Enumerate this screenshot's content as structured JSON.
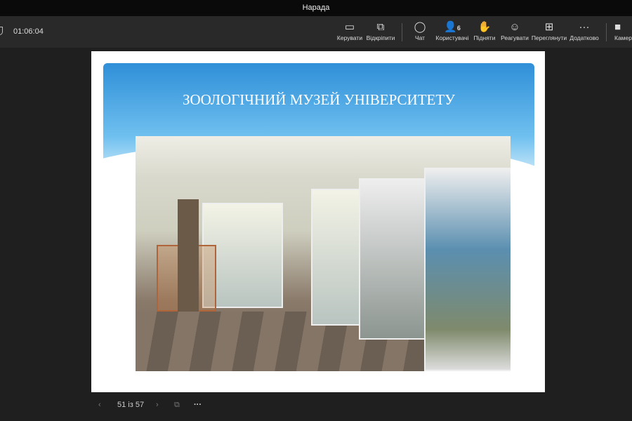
{
  "window": {
    "title": "Нарада"
  },
  "toolbar": {
    "timer": "01:06:04",
    "items": [
      {
        "label": "Керувати",
        "icon": "share-screen-icon"
      },
      {
        "label": "Відкріпити",
        "icon": "popout-icon"
      },
      {
        "label": "Чат",
        "icon": "chat-icon"
      },
      {
        "label": "Користувачі",
        "icon": "people-icon",
        "badge": "6"
      },
      {
        "label": "Підняти",
        "icon": "raise-hand-icon"
      },
      {
        "label": "Реагувати",
        "icon": "smiley-icon"
      },
      {
        "label": "Переглянути",
        "icon": "grid-view-icon"
      },
      {
        "label": "Додатково",
        "icon": "more-icon"
      },
      {
        "label": "Камера",
        "icon": "camera-icon"
      }
    ]
  },
  "slide": {
    "title": "ЗООЛОГІЧНИЙ МУЗЕЙ УНІВЕРСИТЕТУ"
  },
  "pager": {
    "text": "51 із 57"
  }
}
